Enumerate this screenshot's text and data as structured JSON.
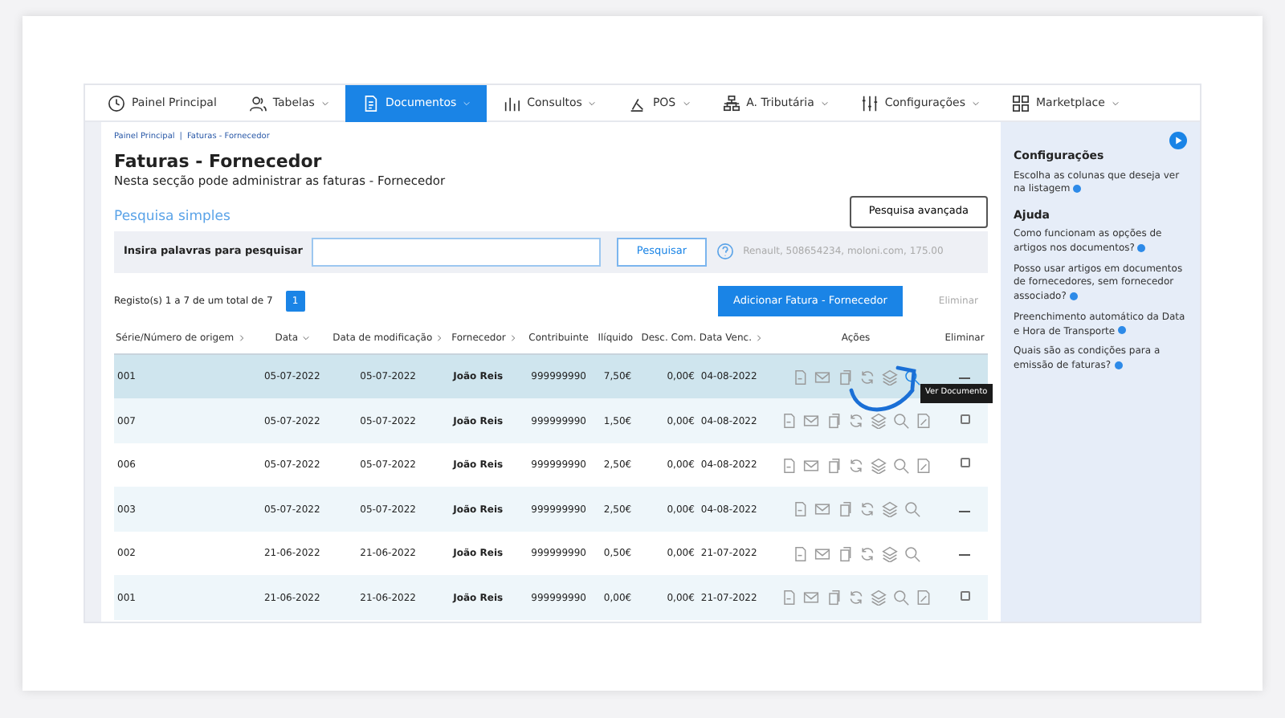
{
  "nav": [
    {
      "label": "Painel Principal",
      "kind": "link",
      "selected": false
    },
    {
      "label": "Tabelas",
      "kind": "menu",
      "selected": false
    },
    {
      "label": "Documentos",
      "kind": "menu",
      "selected": true
    },
    {
      "label": "Consultos",
      "kind": "menu",
      "selected": false
    },
    {
      "label": "POS",
      "kind": "menu",
      "selected": false
    },
    {
      "label": "A. Tributária",
      "kind": "menu",
      "selected": false
    },
    {
      "label": "Configurações",
      "kind": "menu",
      "selected": false
    },
    {
      "label": "Marketplace",
      "kind": "menu",
      "selected": false
    }
  ],
  "breadcrumb": [
    "Painel Principal",
    "Faturas - Fornecedor"
  ],
  "breadcrumb_separator": "|",
  "title": "Faturas - Fornecedor",
  "subtitle": "Nesta secção pode administrar as faturas - Fornecedor",
  "search": {
    "heading": "Pesquisa simples",
    "advanced_button": "Pesquisa avançada",
    "label": "Insira palavras para pesquisar",
    "button": "Pesquisar",
    "hint": "Renault, 508654234, moloni.com, 175.00"
  },
  "records": "Registo(s) 1 a 7 de um total de 7",
  "pages": [
    {
      "label": "1",
      "selected": true
    }
  ],
  "add_button": "Adicionar Fatura - Fornecedor",
  "delete_button": "Eliminar",
  "table": {
    "columns": [
      {
        "label": "Série/Número de origem",
        "kind": "sortable"
      },
      {
        "label": "Data",
        "kind": "sorted"
      },
      {
        "label": "Data de modificação",
        "kind": "sortable"
      },
      {
        "label": "Fornecedor",
        "kind": "sortable"
      },
      {
        "label": "Contribuinte",
        "kind": "plain"
      },
      {
        "label": "Ilíquido",
        "kind": "plain"
      },
      {
        "label": "Desc. Com.",
        "kind": "plain"
      },
      {
        "label": "Data Venc.",
        "kind": "sortable"
      },
      {
        "label": "Ações",
        "kind": "plain"
      },
      {
        "label": "Eliminar",
        "kind": "plain"
      }
    ],
    "rows": [
      {
        "cells": [
          "001",
          "05-07-2022",
          "05-07-2022",
          "João Reis",
          "999999990",
          "7,50€",
          "0,00€",
          "04-08-2022"
        ],
        "selected": true,
        "editable": false
      },
      {
        "cells": [
          "007",
          "05-07-2022",
          "05-07-2022",
          "João Reis",
          "999999990",
          "1,50€",
          "0,00€",
          "04-08-2022"
        ],
        "selected": false,
        "editable": true
      },
      {
        "cells": [
          "006",
          "05-07-2022",
          "05-07-2022",
          "João Reis",
          "999999990",
          "2,50€",
          "0,00€",
          "04-08-2022"
        ],
        "selected": false,
        "editable": true
      },
      {
        "cells": [
          "003",
          "05-07-2022",
          "05-07-2022",
          "João Reis",
          "999999990",
          "2,50€",
          "0,00€",
          "04-08-2022"
        ],
        "selected": false,
        "editable": false
      },
      {
        "cells": [
          "002",
          "21-06-2022",
          "21-06-2022",
          "João Reis",
          "999999990",
          "0,50€",
          "0,00€",
          "21-07-2022"
        ],
        "selected": false,
        "editable": false
      },
      {
        "cells": [
          "001",
          "21-06-2022",
          "21-06-2022",
          "João Reis",
          "999999990",
          "0,00€",
          "0,00€",
          "21-07-2022"
        ],
        "selected": false,
        "editable": true
      }
    ]
  },
  "tooltip": "Ver Documento",
  "sidebar": {
    "sections": [
      {
        "heading": "Configurações",
        "links": [
          "Escolha as colunas que deseja ver na listagem"
        ]
      },
      {
        "heading": "Ajuda",
        "links": [
          "Como funcionam as opções de artigos nos documentos?",
          "Posso usar artigos em documentos de fornecedores, sem fornecedor associado?",
          "Preenchimento automático da Data e Hora de Transporte",
          "Quais são as condições para a emissão de faturas?"
        ]
      }
    ]
  }
}
